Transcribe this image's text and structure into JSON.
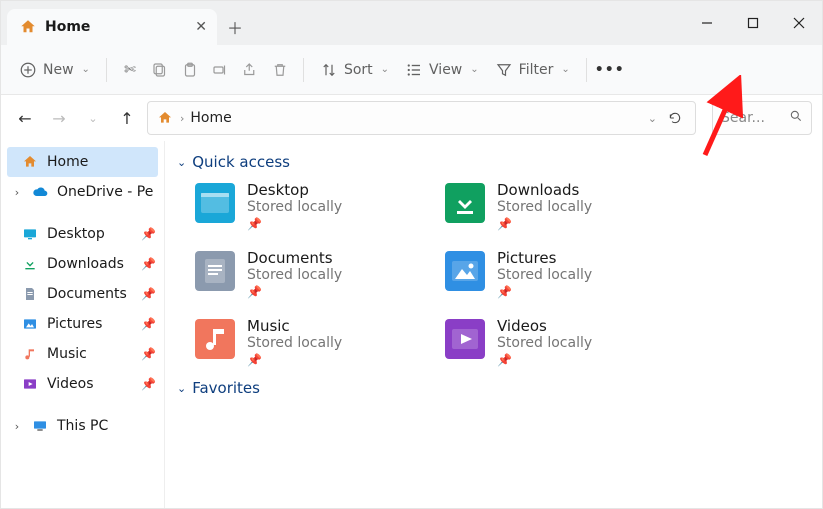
{
  "tab": {
    "title": "Home"
  },
  "toolbar": {
    "new_label": "New",
    "sort_label": "Sort",
    "view_label": "View",
    "filter_label": "Filter"
  },
  "breadcrumb": {
    "current": "Home"
  },
  "search": {
    "placeholder": "Sear..."
  },
  "sidebar": {
    "home": "Home",
    "onedrive": "OneDrive - Pe",
    "desktop": "Desktop",
    "downloads": "Downloads",
    "documents": "Documents",
    "pictures": "Pictures",
    "music": "Music",
    "videos": "Videos",
    "thispc": "This PC"
  },
  "sections": {
    "quick_access": "Quick access",
    "favorites": "Favorites"
  },
  "quick_access": [
    {
      "name": "Desktop",
      "sub": "Stored locally",
      "icon": "desktop",
      "bg": "#1aa7d8"
    },
    {
      "name": "Downloads",
      "sub": "Stored locally",
      "icon": "downloads",
      "bg": "#10a060"
    },
    {
      "name": "Documents",
      "sub": "Stored locally",
      "icon": "documents",
      "bg": "#8b9aae"
    },
    {
      "name": "Pictures",
      "sub": "Stored locally",
      "icon": "pictures",
      "bg": "#2f8fe3"
    },
    {
      "name": "Music",
      "sub": "Stored locally",
      "icon": "music",
      "bg": "#f1765d"
    },
    {
      "name": "Videos",
      "sub": "Stored locally",
      "icon": "videos",
      "bg": "#8a3ec6"
    }
  ]
}
